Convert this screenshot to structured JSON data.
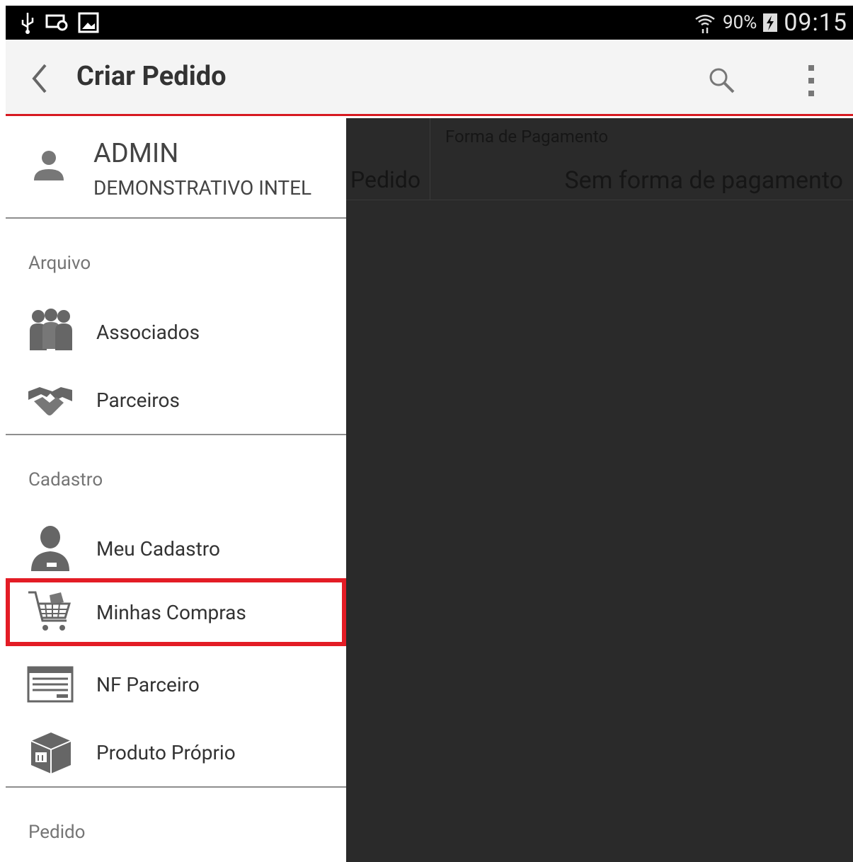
{
  "status_bar": {
    "battery_percent": "90%",
    "time": "09:15",
    "icons": [
      "usb-icon",
      "cast-icon",
      "image-icon",
      "wifi-icon",
      "battery-charging-icon"
    ]
  },
  "action_bar": {
    "title": "Criar Pedido",
    "accent_color": "#d71920"
  },
  "drawer": {
    "user": {
      "name": "ADMIN",
      "company": "DEMONSTRATIVO INTEL"
    },
    "sections": [
      {
        "label": "Arquivo",
        "items": [
          {
            "label": "Associados",
            "icon": "people-group-icon"
          },
          {
            "label": "Parceiros",
            "icon": "handshake-icon"
          }
        ]
      },
      {
        "label": "Cadastro",
        "items": [
          {
            "label": "Meu Cadastro",
            "icon": "person-icon"
          },
          {
            "label": "Minhas Compras",
            "icon": "shopping-cart-icon",
            "highlighted": true
          },
          {
            "label": "NF Parceiro",
            "icon": "invoice-icon"
          },
          {
            "label": "Produto Próprio",
            "icon": "box-icon"
          }
        ]
      },
      {
        "label": "Pedido",
        "items": []
      }
    ]
  },
  "content": {
    "columns": {
      "pedido": "Pedido",
      "forma_label": "Forma de Pagamento",
      "forma_value": "Sem forma de pagamento"
    }
  },
  "colors": {
    "highlight_border": "#e31c25",
    "content_background": "#2a2a2a"
  }
}
